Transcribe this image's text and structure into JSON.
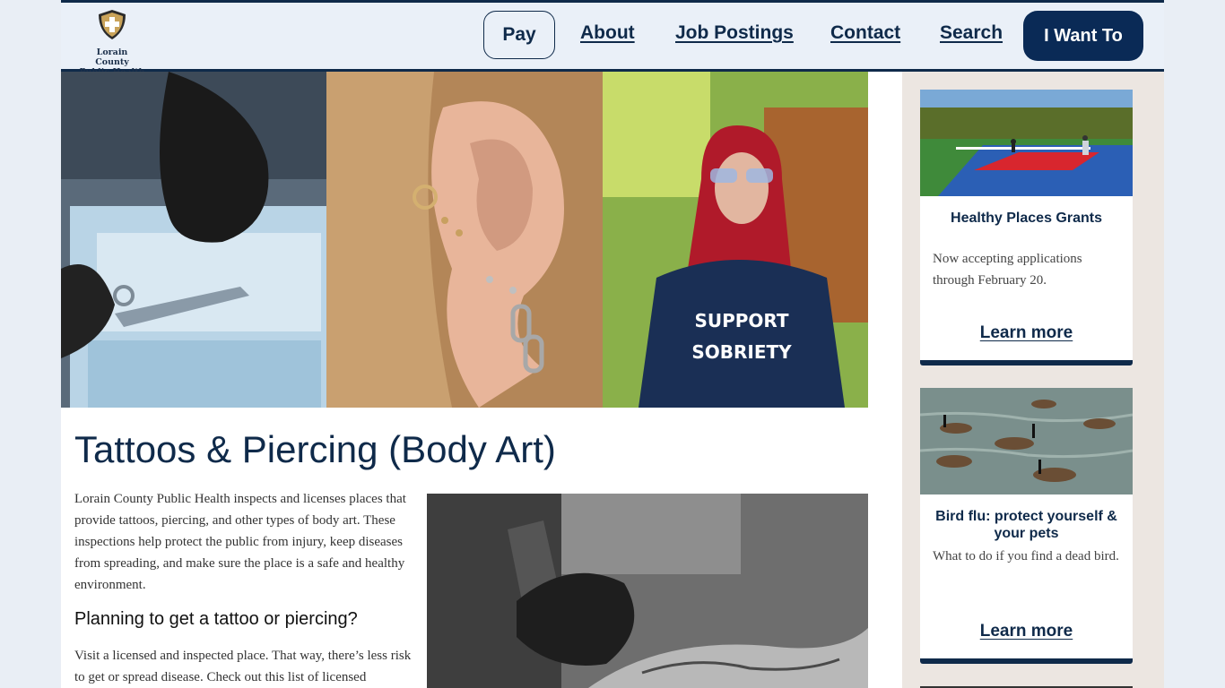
{
  "header": {
    "logo_line1": "Lorain County",
    "logo_line2": "Public Health",
    "nav": {
      "pay": "Pay",
      "about": "About",
      "job_postings": "Job Postings",
      "contact": "Contact",
      "search": "Search",
      "i_want_to": "I Want To"
    }
  },
  "hero": {
    "shirt_line1": "SUPPORT",
    "shirt_line2": "SOBRIETY"
  },
  "main": {
    "title": "Tattoos & Piercing (Body Art)",
    "intro": "Lorain County Public Health inspects and licenses places that provide tattoos, piercing, and other types of body art. These inspections help protect the public from injury, keep diseases from spreading, and make sure the place is a safe and healthy environment.",
    "subheading": "Planning to get a tattoo or piercing?",
    "visit_text": "Visit a licensed and inspected place. That way, there’s less risk to get or spread disease. Check out this list of licensed"
  },
  "sidebar": {
    "cards": [
      {
        "title": "Healthy Places Grants",
        "text": "Now accepting applications through February 20.",
        "link": "Learn more"
      },
      {
        "title": "Bird flu: protect yourself & your pets",
        "text": "What to do if you find a dead bird.",
        "link": "Learn more"
      }
    ]
  },
  "colors": {
    "brand_navy": "#0f2a4a",
    "header_bg": "#eaf0f8",
    "sidebar_bg": "#ece6e1"
  }
}
